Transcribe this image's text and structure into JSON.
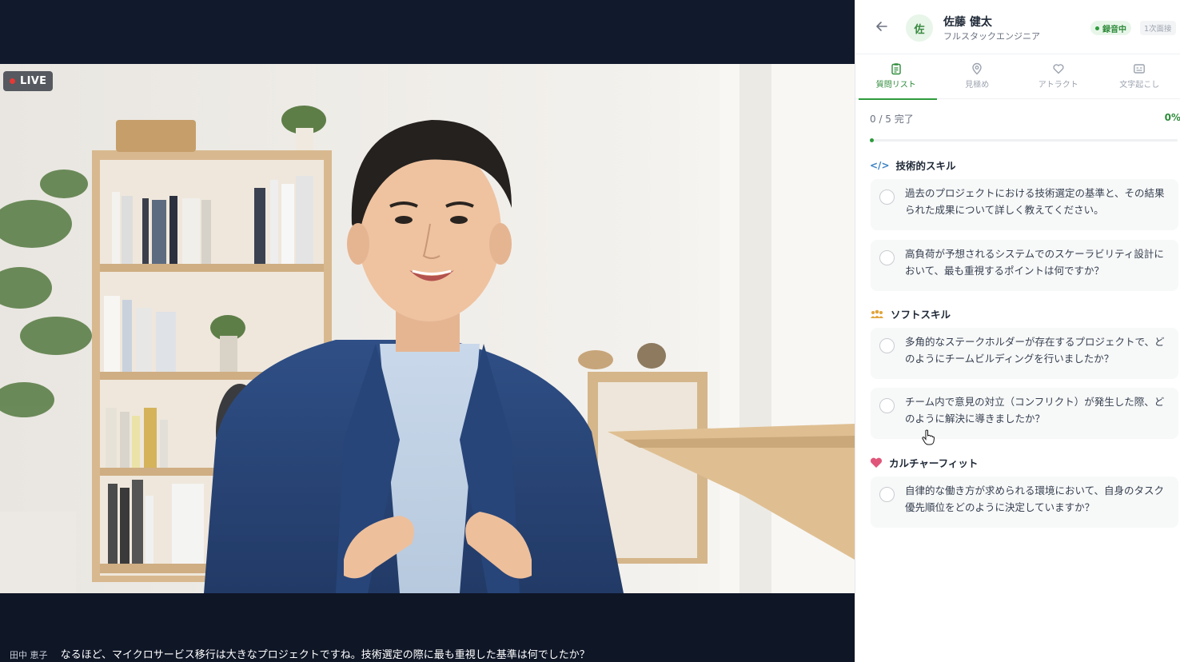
{
  "video": {
    "live_label": "LIVE",
    "subtitle_speaker": "田中 恵子",
    "subtitle_text": "なるほど、マイクロサービス移行は大きなプロジェクトですね。技術選定の際に最も重視した基準は何でしたか？"
  },
  "candidate": {
    "avatar_initial": "佐",
    "name": "佐藤 健太",
    "role": "フルスタックエンジニア",
    "recording_label": "録音中",
    "round_label": "1次面接"
  },
  "tabs": [
    {
      "label": "質問リスト",
      "icon": "clipboard-icon",
      "active": true
    },
    {
      "label": "見極め",
      "icon": "location-pin-icon",
      "active": false
    },
    {
      "label": "アトラクト",
      "icon": "heart-icon",
      "active": false
    },
    {
      "label": "文字起こし",
      "icon": "caption-icon",
      "active": false
    }
  ],
  "progress": {
    "label": "0 / 5 完了",
    "percent_label": "0%",
    "value": 0
  },
  "sections": [
    {
      "title": "技術的スキル",
      "icon": "</>",
      "questions": [
        {
          "text": "過去のプロジェクトにおける技術選定の基準と、その結果られた成果について詳しく教えてください。",
          "checked": false
        },
        {
          "text": "高負荷が予想されるシステムでのスケーラビリティ設計において、最も重視するポイントは何ですか？",
          "checked": false
        }
      ]
    },
    {
      "title": "ソフトスキル",
      "icon": "team-icon",
      "questions": [
        {
          "text": "多角的なステークホルダーが存在するプロジェクトで、どのようにチームビルディングを行いましたか？",
          "checked": false
        },
        {
          "text": "チーム内で意見の対立（コンフリクト）が発生した際、どのように解決に導きましたか？",
          "checked": false
        }
      ]
    },
    {
      "title": "カルチャーフィット",
      "icon": "heart-icon",
      "questions": [
        {
          "text": "自律的な働き方が求められる環境において、自身のタスク優先順位をどのように決定していますか？",
          "checked": false
        }
      ]
    }
  ],
  "colors": {
    "accent": "#2e9b3c",
    "live": "#e53935",
    "panel_bg": "#ffffff",
    "video_bg": "#111a2c"
  }
}
